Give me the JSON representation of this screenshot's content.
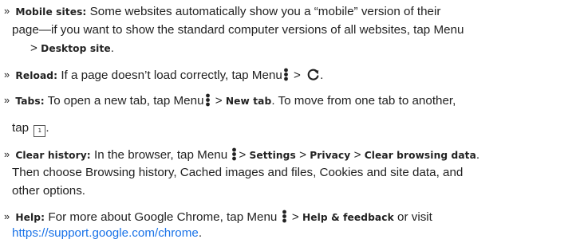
{
  "bullet": "»",
  "items": {
    "mobile": {
      "title": "Mobile sites:",
      "text1": "Some websites automatically show you a “mobile” version of their",
      "text2": "page—if you want to show the standard computer versions of all websites, tap Menu",
      "gt": ">",
      "link": "Desktop site",
      "end": "."
    },
    "reload": {
      "title": "Reload:",
      "text1": "If a page doesn’t load correctly, tap Menu",
      "gt": ">",
      "end": "."
    },
    "tabs": {
      "title": "Tabs:",
      "text1": "To open a new tab, tap Menu",
      "gt": ">",
      "link": "New tab",
      "text2": ". To move from one tab to another,",
      "text3": "tap",
      "tab_count": "1",
      "end": "."
    },
    "history": {
      "title": "Clear history:",
      "text1": "In the browser, tap Menu",
      "gt1": ">",
      "settings": "Settings",
      "gt2": ">",
      "privacy": "Privacy",
      "gt3": ">",
      "clear": "Clear browsing data",
      "end": ".",
      "text2": "Then choose Browsing history, Cached images and files, Cookies and site data, and",
      "text3": "other options."
    },
    "help": {
      "title": "Help:",
      "text1": "For more about Google Chrome, tap Menu",
      "gt": ">",
      "link": "Help & feedback",
      "text2": "or visit",
      "url": "https://support.google.com/chrome",
      "end": "."
    }
  },
  "icons": {
    "menu": "three-dot-menu-icon",
    "reload": "reload-icon",
    "tabs": "tab-switcher-icon"
  },
  "colors": {
    "text": "#222222",
    "link": "#1a73e8"
  }
}
